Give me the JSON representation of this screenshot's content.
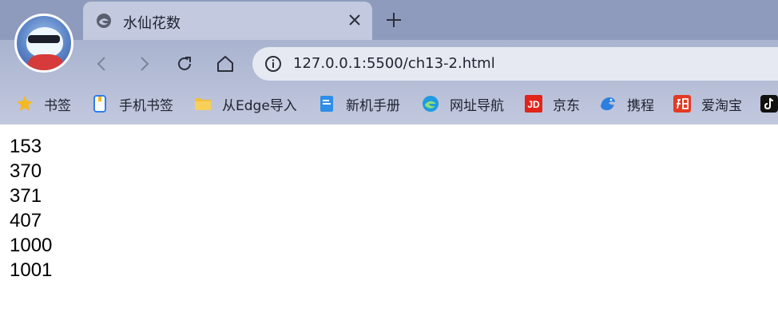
{
  "browser": {
    "tab": {
      "title": "水仙花数",
      "icon": "edge-logo-icon"
    },
    "address_bar": {
      "url": "127.0.0.1:5500/ch13-2.html",
      "icon": "info-icon"
    },
    "nav": [
      "back-icon",
      "forward-icon",
      "reload-icon",
      "home-icon"
    ],
    "bookmarks": [
      {
        "label": "书签",
        "icon": "star-icon",
        "color": "#f5b820"
      },
      {
        "label": "手机书签",
        "icon": "phone-bookmark-icon",
        "color": "#2f7ee8"
      },
      {
        "label": "从Edge导入",
        "icon": "folder-icon",
        "color": "#f2c039"
      },
      {
        "label": "新机手册",
        "icon": "document-icon",
        "color": "#2f8ee8"
      },
      {
        "label": "网址导航",
        "icon": "edge-icon",
        "color": "#1f9be0"
      },
      {
        "label": "京东",
        "icon": "jd-icon",
        "color": "#e1251b"
      },
      {
        "label": "携程",
        "icon": "ctrip-dolphin-icon",
        "color": "#2b7fe0"
      },
      {
        "label": "爱淘宝",
        "icon": "taobao-icon",
        "color": "#e53a22"
      },
      {
        "label": "",
        "icon": "tiktok-icon",
        "color": "#111111"
      }
    ]
  },
  "page": {
    "lines": [
      "153",
      "370",
      "371",
      "407",
      "1000",
      "1001"
    ]
  }
}
